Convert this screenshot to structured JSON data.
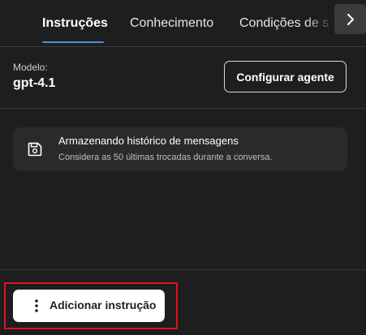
{
  "tabs": {
    "items": [
      {
        "label": "Instruções",
        "active": true
      },
      {
        "label": "Conhecimento",
        "active": false
      },
      {
        "label": "Condições de s",
        "active": false
      }
    ],
    "scroll_icon": "chevron-right-icon"
  },
  "model": {
    "label": "Modelo:",
    "value": "gpt-4.1",
    "configure_label": "Configurar agente"
  },
  "history": {
    "icon": "save-icon",
    "title": "Armazenando histórico de mensagens",
    "subtitle": "Considera as 50 últimas trocadas durante a conversa."
  },
  "actions": {
    "add_instruction_label": "Adicionar instrução",
    "add_instruction_icon": "more-vertical-icon"
  },
  "colors": {
    "background": "#1e1e1e",
    "tab_underline": "#4a90e2",
    "card": "#2a2a2a",
    "highlight_border": "#e0121b"
  }
}
